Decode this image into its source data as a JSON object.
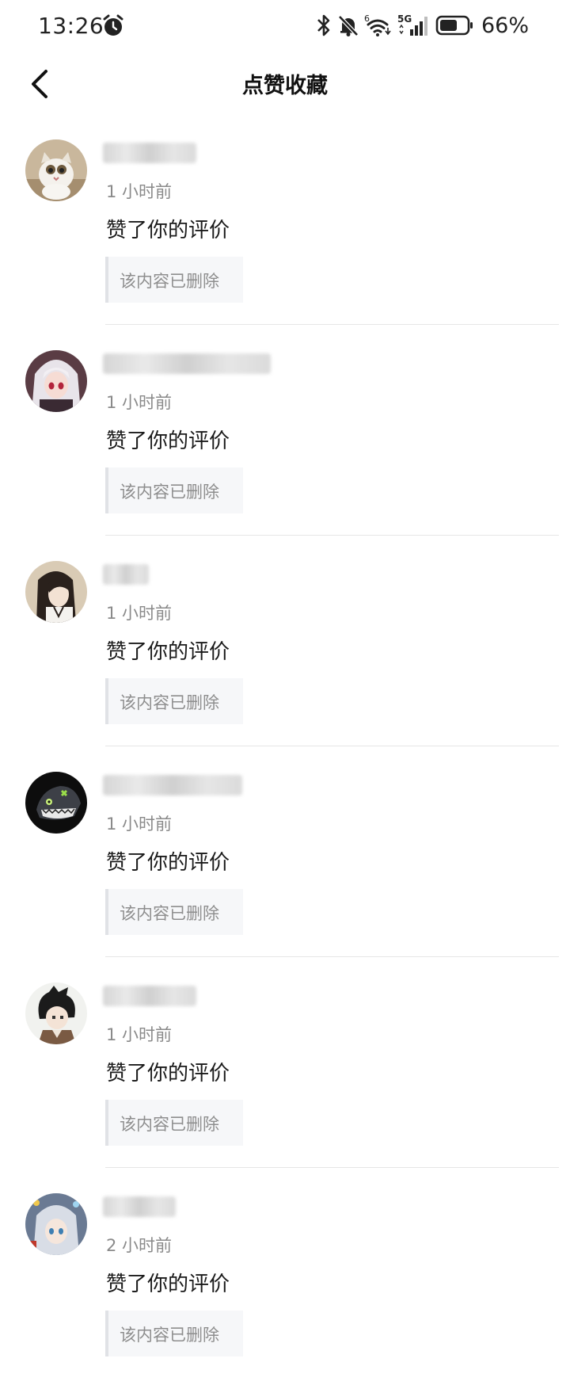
{
  "status_bar": {
    "time": "13:26",
    "network_label": "5G",
    "wifi_label": "6",
    "battery_percent": "66%",
    "battery_level": 0.66
  },
  "header": {
    "title": "点赞收藏"
  },
  "notifications": [
    {
      "time": "1 小时前",
      "action": "赞了你的评价",
      "quote": "该内容已删除"
    },
    {
      "time": "1 小时前",
      "action": "赞了你的评价",
      "quote": "该内容已删除"
    },
    {
      "time": "1 小时前",
      "action": "赞了你的评价",
      "quote": "该内容已删除"
    },
    {
      "time": "1 小时前",
      "action": "赞了你的评价",
      "quote": "该内容已删除"
    },
    {
      "time": "1 小时前",
      "action": "赞了你的评价",
      "quote": "该内容已删除"
    },
    {
      "time": "2 小时前",
      "action": "赞了你的评价",
      "quote": "该内容已删除"
    }
  ],
  "icons": {
    "alarm": "alarm-icon",
    "bluetooth": "bluetooth-icon",
    "mute": "mute-icon",
    "wifi": "wifi-icon",
    "signal": "signal-icon",
    "battery": "battery-icon",
    "back": "chevron-left-icon"
  }
}
